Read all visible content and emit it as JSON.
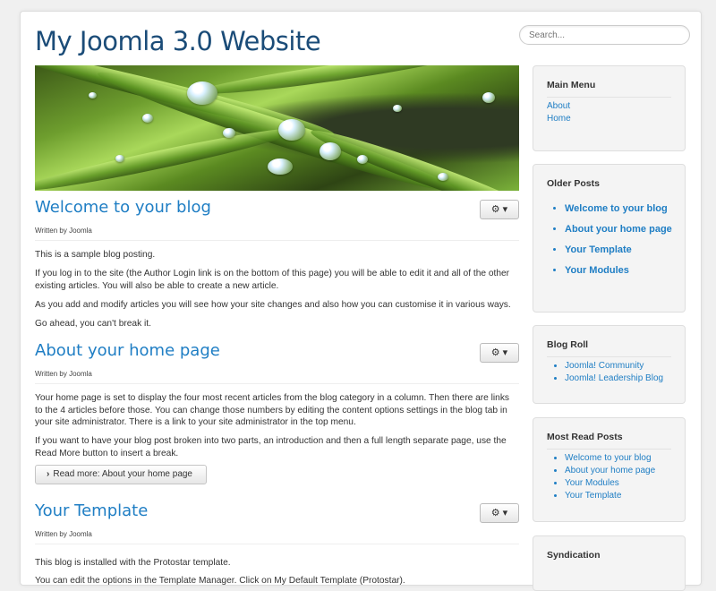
{
  "site": {
    "title": "My Joomla 3.0 Website"
  },
  "search": {
    "placeholder": "Search..."
  },
  "hero": {
    "alt": ""
  },
  "articles": [
    {
      "title": "Welcome to your blog",
      "author": "Written by Joomla",
      "gear": "⚙ ▾",
      "paragraphs": [
        "This is a sample blog posting.",
        "If you log in to the site (the Author Login link is on the bottom of this page) you will be able to edit it and all of the other existing articles. You will also be able to create a new article.",
        "As you add and modify articles you will see how your site changes and also how you can customise it in various ways.",
        "Go ahead, you can't break it."
      ]
    },
    {
      "title": "About your home page",
      "author": "Written by Joomla",
      "gear": "⚙ ▾",
      "paragraphs": [
        "Your home page is set to display the four most recent articles from the blog category in a column. Then there are links to the 4 articles before those. You can change those numbers by editing the content options settings in the blog tab in your site administrator. There is a link to your site administrator in the top menu.",
        "If you want to have your blog post broken into two parts, an introduction and then a full length separate page, use the Read More button to insert a break."
      ],
      "readmore": "Read more: About your home page"
    },
    {
      "title": "Your Template",
      "author": "Written by Joomla",
      "gear": "⚙ ▾",
      "paragraphs": [
        "This blog is installed with the Protostar template.",
        "You can edit the options in the Template Manager. Click on My Default Template (Protostar)."
      ]
    }
  ],
  "sidebar": {
    "main_menu": {
      "title": "Main Menu",
      "items": [
        "About",
        "Home"
      ]
    },
    "older_posts": {
      "title": "Older Posts",
      "items": [
        "Welcome to your blog",
        "About your home page",
        "Your Template",
        "Your Modules"
      ]
    },
    "blog_roll": {
      "title": "Blog Roll",
      "items": [
        "Joomla! Community",
        "Joomla! Leadership Blog"
      ]
    },
    "most_read": {
      "title": "Most Read Posts",
      "items": [
        "Welcome to your blog",
        "About your home page",
        "Your Modules",
        "Your Template"
      ]
    },
    "syndication": {
      "title": "Syndication"
    }
  },
  "colors": {
    "title": "#1b4c78",
    "link": "#1f7ec4",
    "panel": "#f4f4f4"
  }
}
